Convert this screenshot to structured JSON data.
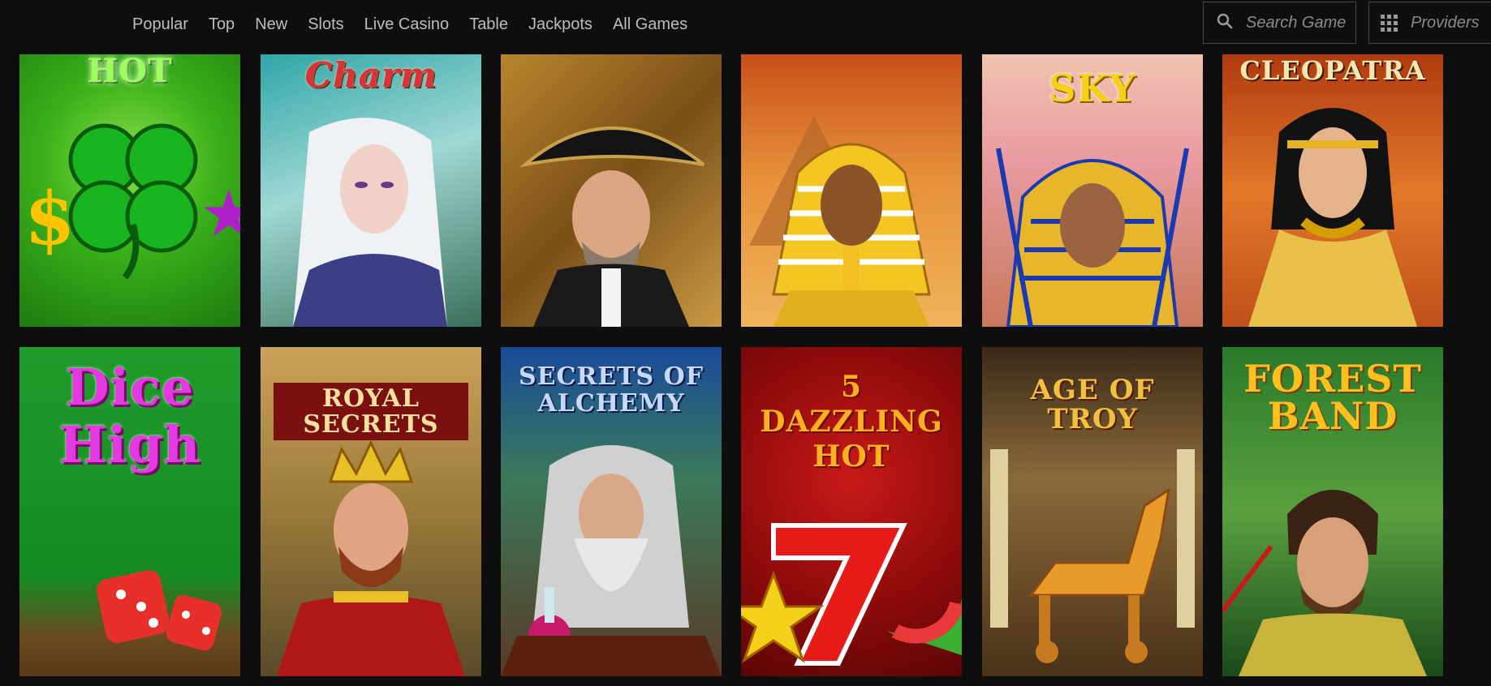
{
  "nav": {
    "items": [
      "Popular",
      "Top",
      "New",
      "Slots",
      "Live Casino",
      "Table",
      "Jackpots",
      "All Games"
    ]
  },
  "search": {
    "placeholder": "Search Game"
  },
  "providers": {
    "label": "Providers"
  },
  "games": {
    "row1": [
      {
        "title": "HOT"
      },
      {
        "title": "Charm"
      },
      {
        "title": ""
      },
      {
        "title": ""
      },
      {
        "title": "SKY"
      },
      {
        "title": "CLEOPATRA"
      }
    ],
    "row2": [
      {
        "title": "Dice High"
      },
      {
        "title": "ROYAL SECRETS"
      },
      {
        "title": "SECRETS OF ALCHEMY"
      },
      {
        "title": "5 DAZZLING HOT"
      },
      {
        "title": "AGE OF TROY"
      },
      {
        "title": "FOREST BAND"
      }
    ]
  },
  "colors": {
    "background": "#0e0e0e",
    "nav_text": "#bdbdbd",
    "border": "#4a4a4a"
  }
}
